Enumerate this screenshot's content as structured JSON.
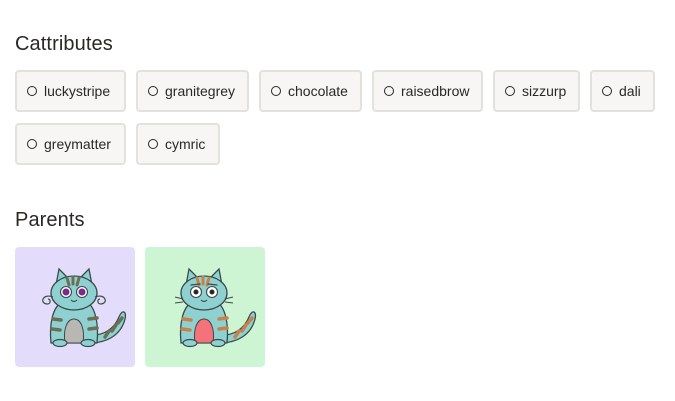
{
  "cattributes": {
    "title": "Cattributes",
    "items": [
      {
        "label": "luckystripe"
      },
      {
        "label": "granitegrey"
      },
      {
        "label": "chocolate"
      },
      {
        "label": "raisedbrow"
      },
      {
        "label": "sizzurp"
      },
      {
        "label": "dali"
      },
      {
        "label": "greymatter"
      },
      {
        "label": "cymric"
      }
    ]
  },
  "parents": {
    "title": "Parents",
    "cards": [
      {
        "background": "#e3ddfb"
      },
      {
        "background": "#cdf5d4"
      }
    ]
  },
  "colors": {
    "chip_background": "#f7f6f4",
    "chip_border": "#e3e1dd",
    "text": "#2a2825"
  }
}
